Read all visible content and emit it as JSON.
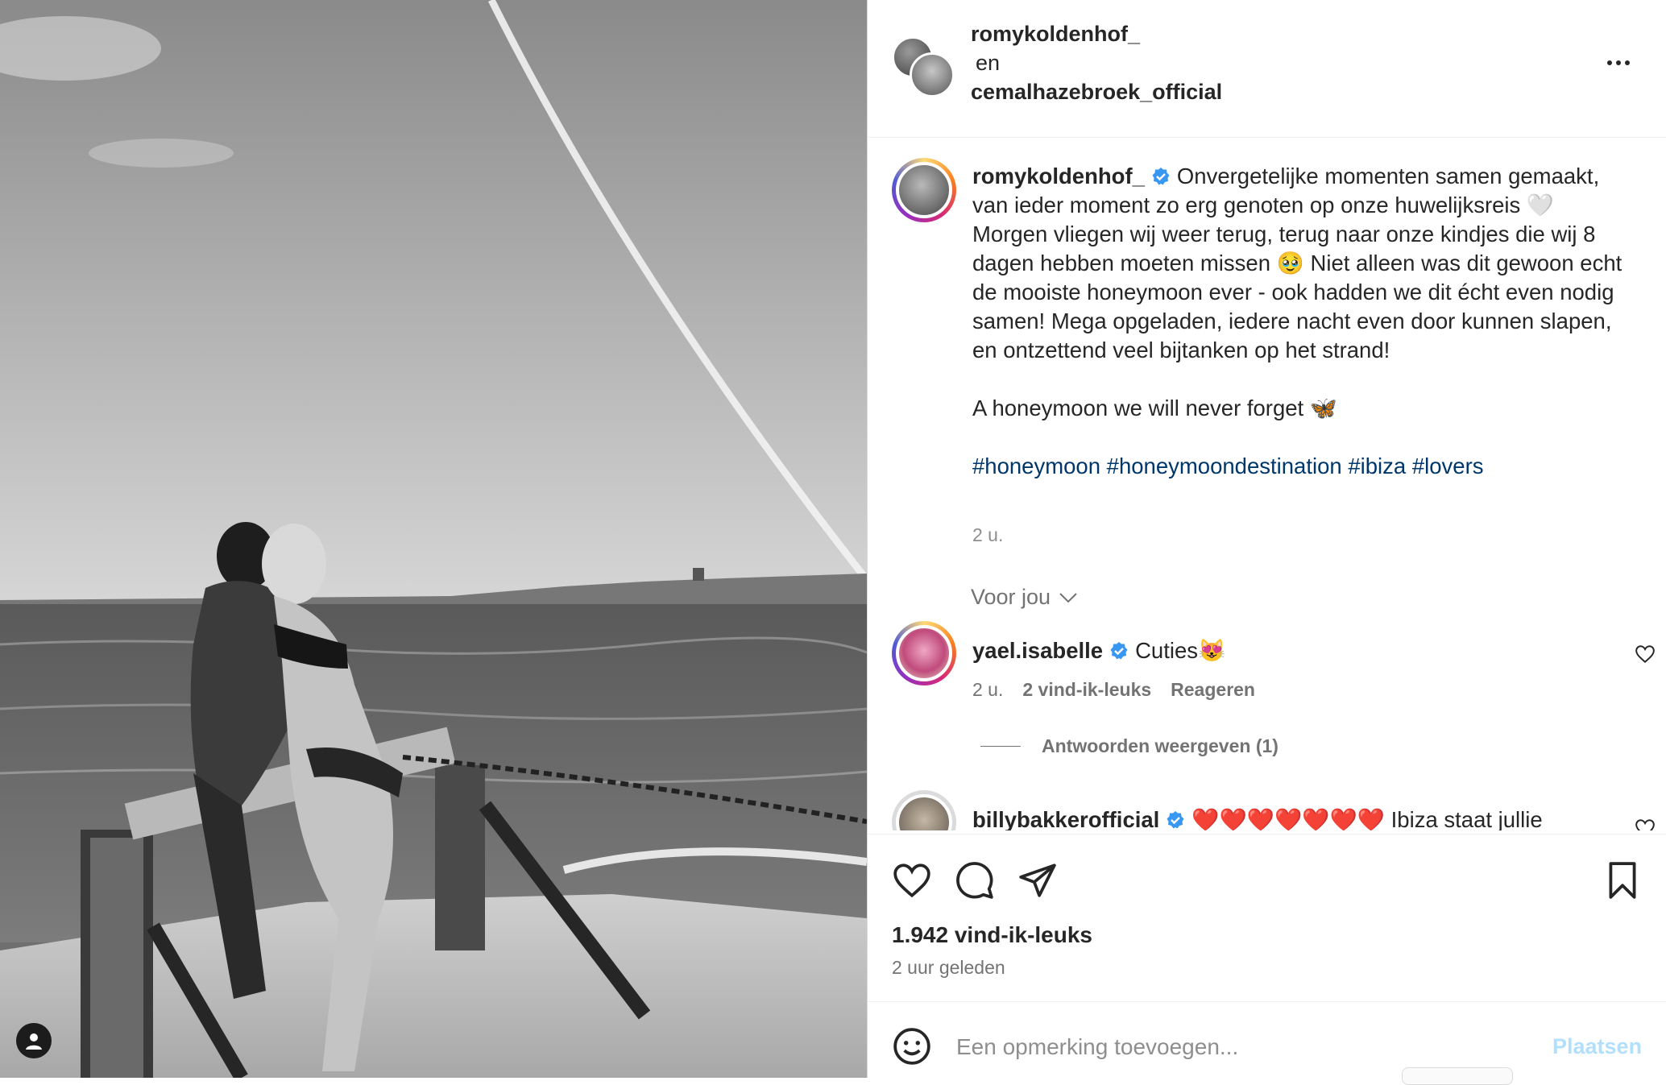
{
  "photo": {
    "description_icon": "user-tag-icon"
  },
  "header": {
    "author": "romykoldenhof_",
    "joiner": "en",
    "coauthor": "cemalhazebroek_official",
    "more_icon": "more-horizontal-icon"
  },
  "caption": {
    "user": "romykoldenhof_",
    "body": "Onvergetelijke momenten samen gemaakt, van ieder moment zo erg genoten op onze huwelijksreis 🤍 Morgen vliegen wij weer terug, terug naar onze kindjes die wij 8 dagen hebben moeten missen 🥹 Niet alleen was dit gewoon echt de mooiste honeymoon ever - ook hadden we dit écht even nodig samen! Mega opgeladen, iedere nacht even door kunnen slapen, en ontzettend veel bijtanken op het strand!",
    "line2": "A honeymoon we will never forget 🦋",
    "hashtags": [
      "#honeymoon",
      "#honeymoondestination",
      "#ibiza",
      "#lovers"
    ],
    "time": "2 u."
  },
  "section_label": "Voor jou",
  "comments": [
    {
      "user": "yael.isabelle",
      "text": "Cuties😻",
      "time": "2 u.",
      "likes": "2 vind-ik-leuks",
      "reply": "Reageren",
      "view_replies": "Antwoorden weergeven (1)"
    },
    {
      "user": "billybakkerofficial",
      "text": "❤️❤️❤️❤️❤️❤️❤️ Ibiza staat jullie"
    }
  ],
  "stats": {
    "likes": "1.942 vind-ik-leuks",
    "posted": "2 uur geleden"
  },
  "comment_box": {
    "placeholder": "Een opmerking toevoegen...",
    "submit": "Plaatsen"
  },
  "colors": {
    "verified": "#3897f0",
    "link": "#00376b",
    "submit_disabled": "#b2dffc"
  }
}
